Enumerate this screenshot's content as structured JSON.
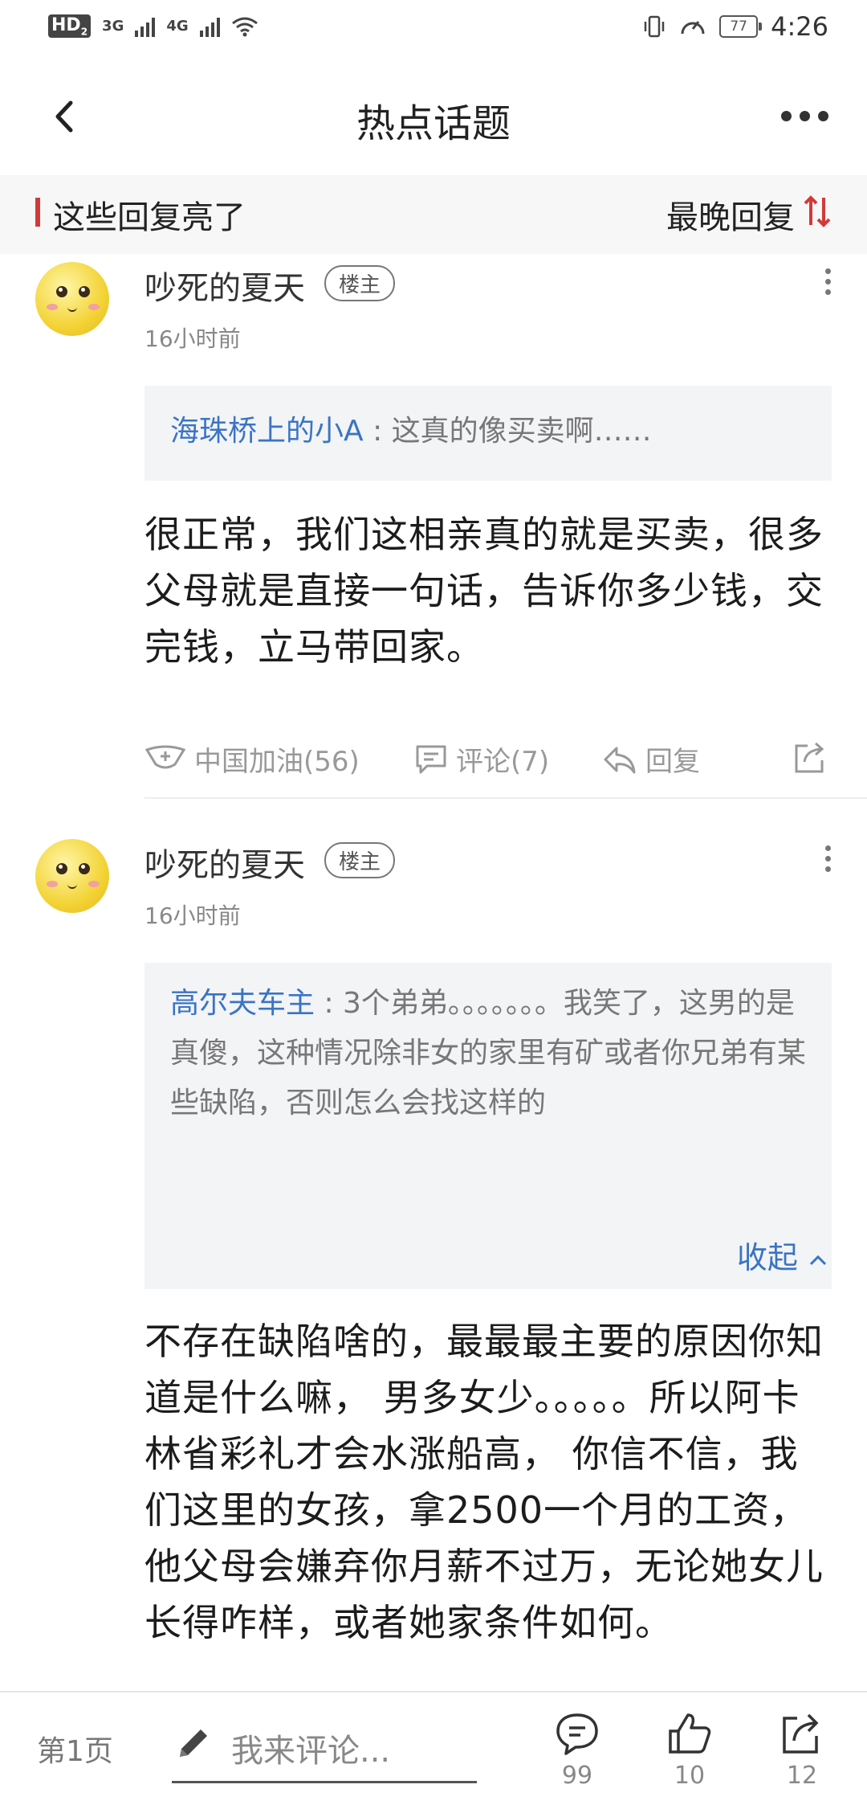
{
  "status_bar": {
    "hd": "HD",
    "hd_sub": "2",
    "net1": "3G",
    "net2": "4G",
    "battery": "77",
    "time": "4:26"
  },
  "header": {
    "title": "热点话题"
  },
  "filter_bar": {
    "title": "这些回复亮了",
    "sort_label": "最晚回复"
  },
  "posts": [
    {
      "user": "吵死的夏天",
      "badge": "楼主",
      "time": "16小时前",
      "quote_user": "海珠桥上的小A",
      "quote_text": " : 这真的像买卖啊……",
      "text": "很正常，我们这相亲真的就是买卖，很多父母就是直接一句话，告诉你多少钱，交完钱，立马带回家。",
      "actions": {
        "cheer": "中国加油(56)",
        "comment": "评论(7)",
        "reply": "回复"
      }
    },
    {
      "user": "吵死的夏天",
      "badge": "楼主",
      "time": "16小时前",
      "quote_user": "高尔夫车主",
      "quote_text": " : 3个弟弟。。。。。。。我笑了，这男的是真傻，这种情况除非女的家里有矿或者你兄弟有某些缺陷，否则怎么会找这样的",
      "collapse_label": "收起",
      "text": "不存在缺陷啥的，最最最主要的原因你知道是什么嘛， 男多女少。。。。。所以阿卡林省彩礼才会水涨船高， 你信不信，我们这里的女孩，拿2500一个月的工资，他父母会嫌弃你月薪不过万，无论她女儿长得咋样，或者她家条件如何。"
    }
  ],
  "bottom_bar": {
    "page": "第1页",
    "comment_placeholder": "我来评论...",
    "comments_count": "99",
    "likes_count": "10",
    "shares_count": "12"
  },
  "colors": {
    "accent_blue": "#3a74c4",
    "red_marker": "#d23a3a"
  }
}
